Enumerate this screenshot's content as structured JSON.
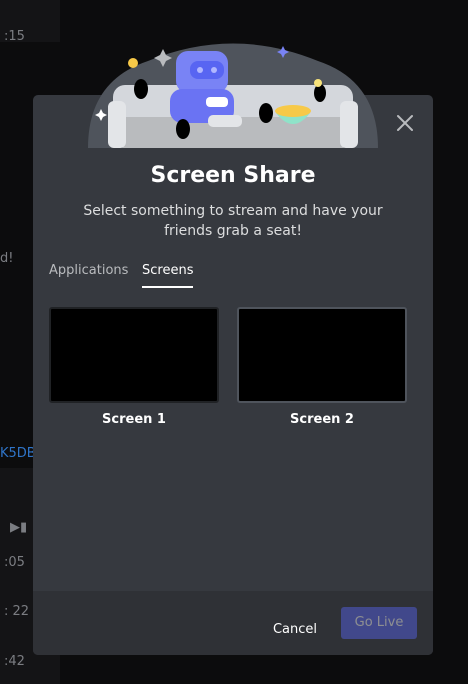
{
  "background": {
    "timestamps": [
      ":15",
      ":05",
      ": 22",
      ":42"
    ],
    "fragment_text": "d!",
    "link_fragment": "K5DB"
  },
  "modal": {
    "title": "Screen Share",
    "subtitle": "Select something to stream and have your friends grab a seat!",
    "tabs": [
      {
        "label": "Applications",
        "active": false
      },
      {
        "label": "Screens",
        "active": true
      }
    ],
    "screens": [
      {
        "label": "Screen 1"
      },
      {
        "label": "Screen 2"
      }
    ],
    "footer": {
      "cancel_label": "Cancel",
      "go_live_label": "Go Live"
    },
    "icons": {
      "close": "close-icon",
      "illustration": "wumpus-couch-illustration"
    }
  },
  "colors": {
    "modal_bg": "#36393f",
    "footer_bg": "#2f3136",
    "accent": "#5865f2",
    "tab_active": "#ffffff",
    "tab_inactive": "#b9bbbe"
  }
}
